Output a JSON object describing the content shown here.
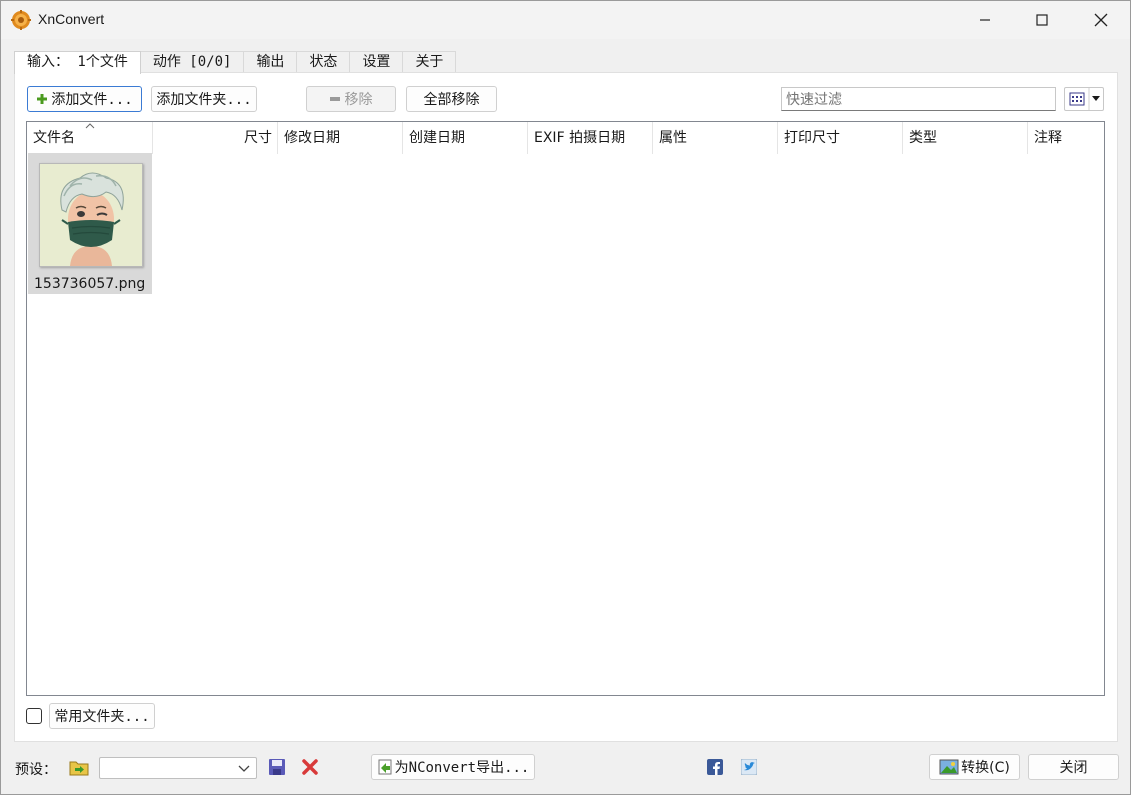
{
  "window": {
    "title": "XnConvert"
  },
  "tabs": [
    {
      "label": "输入： 1个文件",
      "active": true
    },
    {
      "label": "动作 [0/0]",
      "active": false
    },
    {
      "label": "输出",
      "active": false
    },
    {
      "label": "状态",
      "active": false
    },
    {
      "label": "设置",
      "active": false
    },
    {
      "label": "关于",
      "active": false
    }
  ],
  "toolbar": {
    "add_files": "添加文件...",
    "add_folder": "添加文件夹...",
    "remove": "移除",
    "remove_all": "全部移除",
    "filter_placeholder": "快速过滤"
  },
  "columns": [
    "文件名",
    "尺寸",
    "修改日期",
    "创建日期",
    "EXIF 拍摄日期",
    "属性",
    "打印尺寸",
    "类型",
    "注释"
  ],
  "files": [
    {
      "name": "153736057.png"
    }
  ],
  "footer": {
    "favorite_folders": "常用文件夹...",
    "preset_label": "预设：",
    "export_nconvert": "为NConvert导出...",
    "convert": "转换(C)",
    "close": "关闭"
  },
  "colors": {
    "accent": "#3b7bd4",
    "thumb_bg": "#e8ecd0",
    "mask": "#2f5a4a"
  }
}
